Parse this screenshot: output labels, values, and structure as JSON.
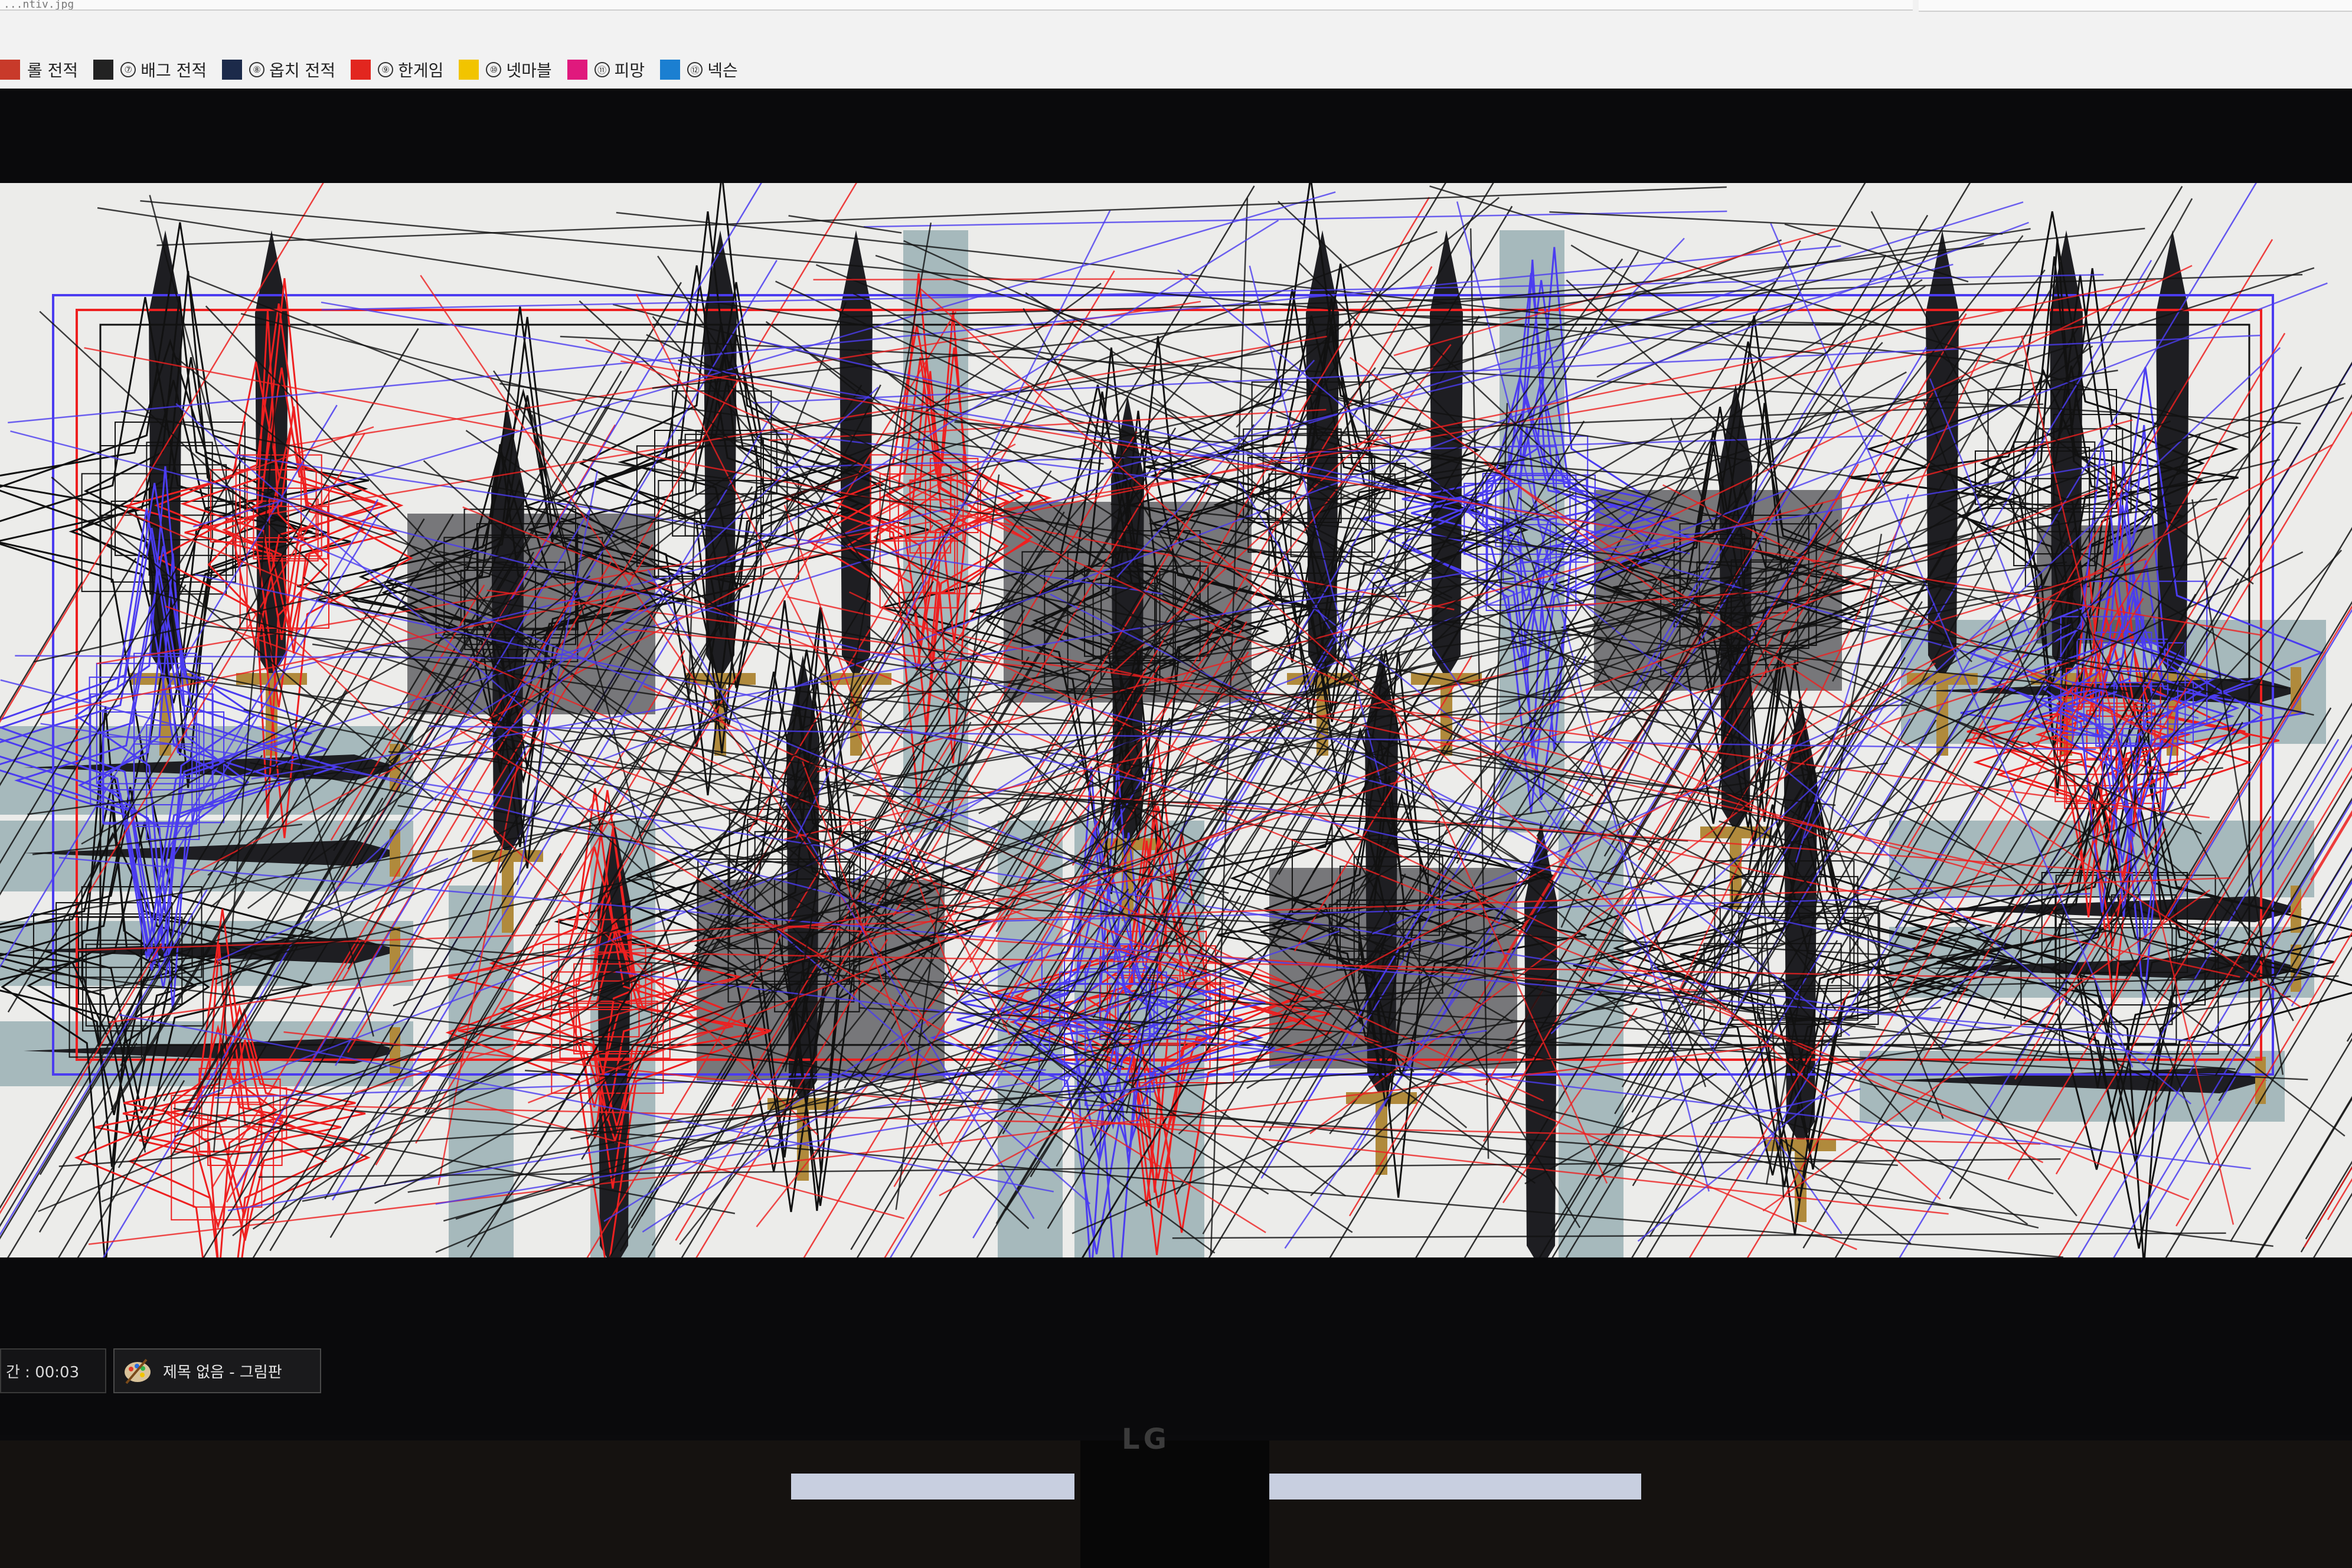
{
  "browser": {
    "url_fragment": "...ntiv.jpg",
    "bookmarks": [
      {
        "icon": "list-icon",
        "color": "#c83a2a",
        "num": "",
        "label": "롤 전적"
      },
      {
        "icon": "pubg-icon",
        "color": "#222222",
        "num": "⑦",
        "label": "배그 전적"
      },
      {
        "icon": "overwatch-icon",
        "color": "#1c2a4a",
        "num": "⑧",
        "label": "옵치 전적"
      },
      {
        "icon": "hangame-icon",
        "color": "#e2261f",
        "num": "⑨",
        "label": "한게임"
      },
      {
        "icon": "netmarble-icon",
        "color": "#f2c400",
        "num": "⑩",
        "label": "넷마블"
      },
      {
        "icon": "pmang-icon",
        "color": "#e0197d",
        "num": "⑪",
        "label": "피망"
      },
      {
        "icon": "nexon-icon",
        "color": "#1b7fd1",
        "num": "⑫",
        "label": "넥슨"
      }
    ]
  },
  "colors": {
    "black_stroke": "#111111",
    "red_stroke": "#ee2020",
    "blue_stroke": "#4b3cf0",
    "sword_blade": "#1e1e22",
    "sword_gold": "#b08a3c",
    "sword_panel": "#6e8f95"
  },
  "taskbar": {
    "clock": "간 : 00:03",
    "paint_title": "제목 없음 - 그림판"
  },
  "monitor": {
    "brand": "LG"
  }
}
